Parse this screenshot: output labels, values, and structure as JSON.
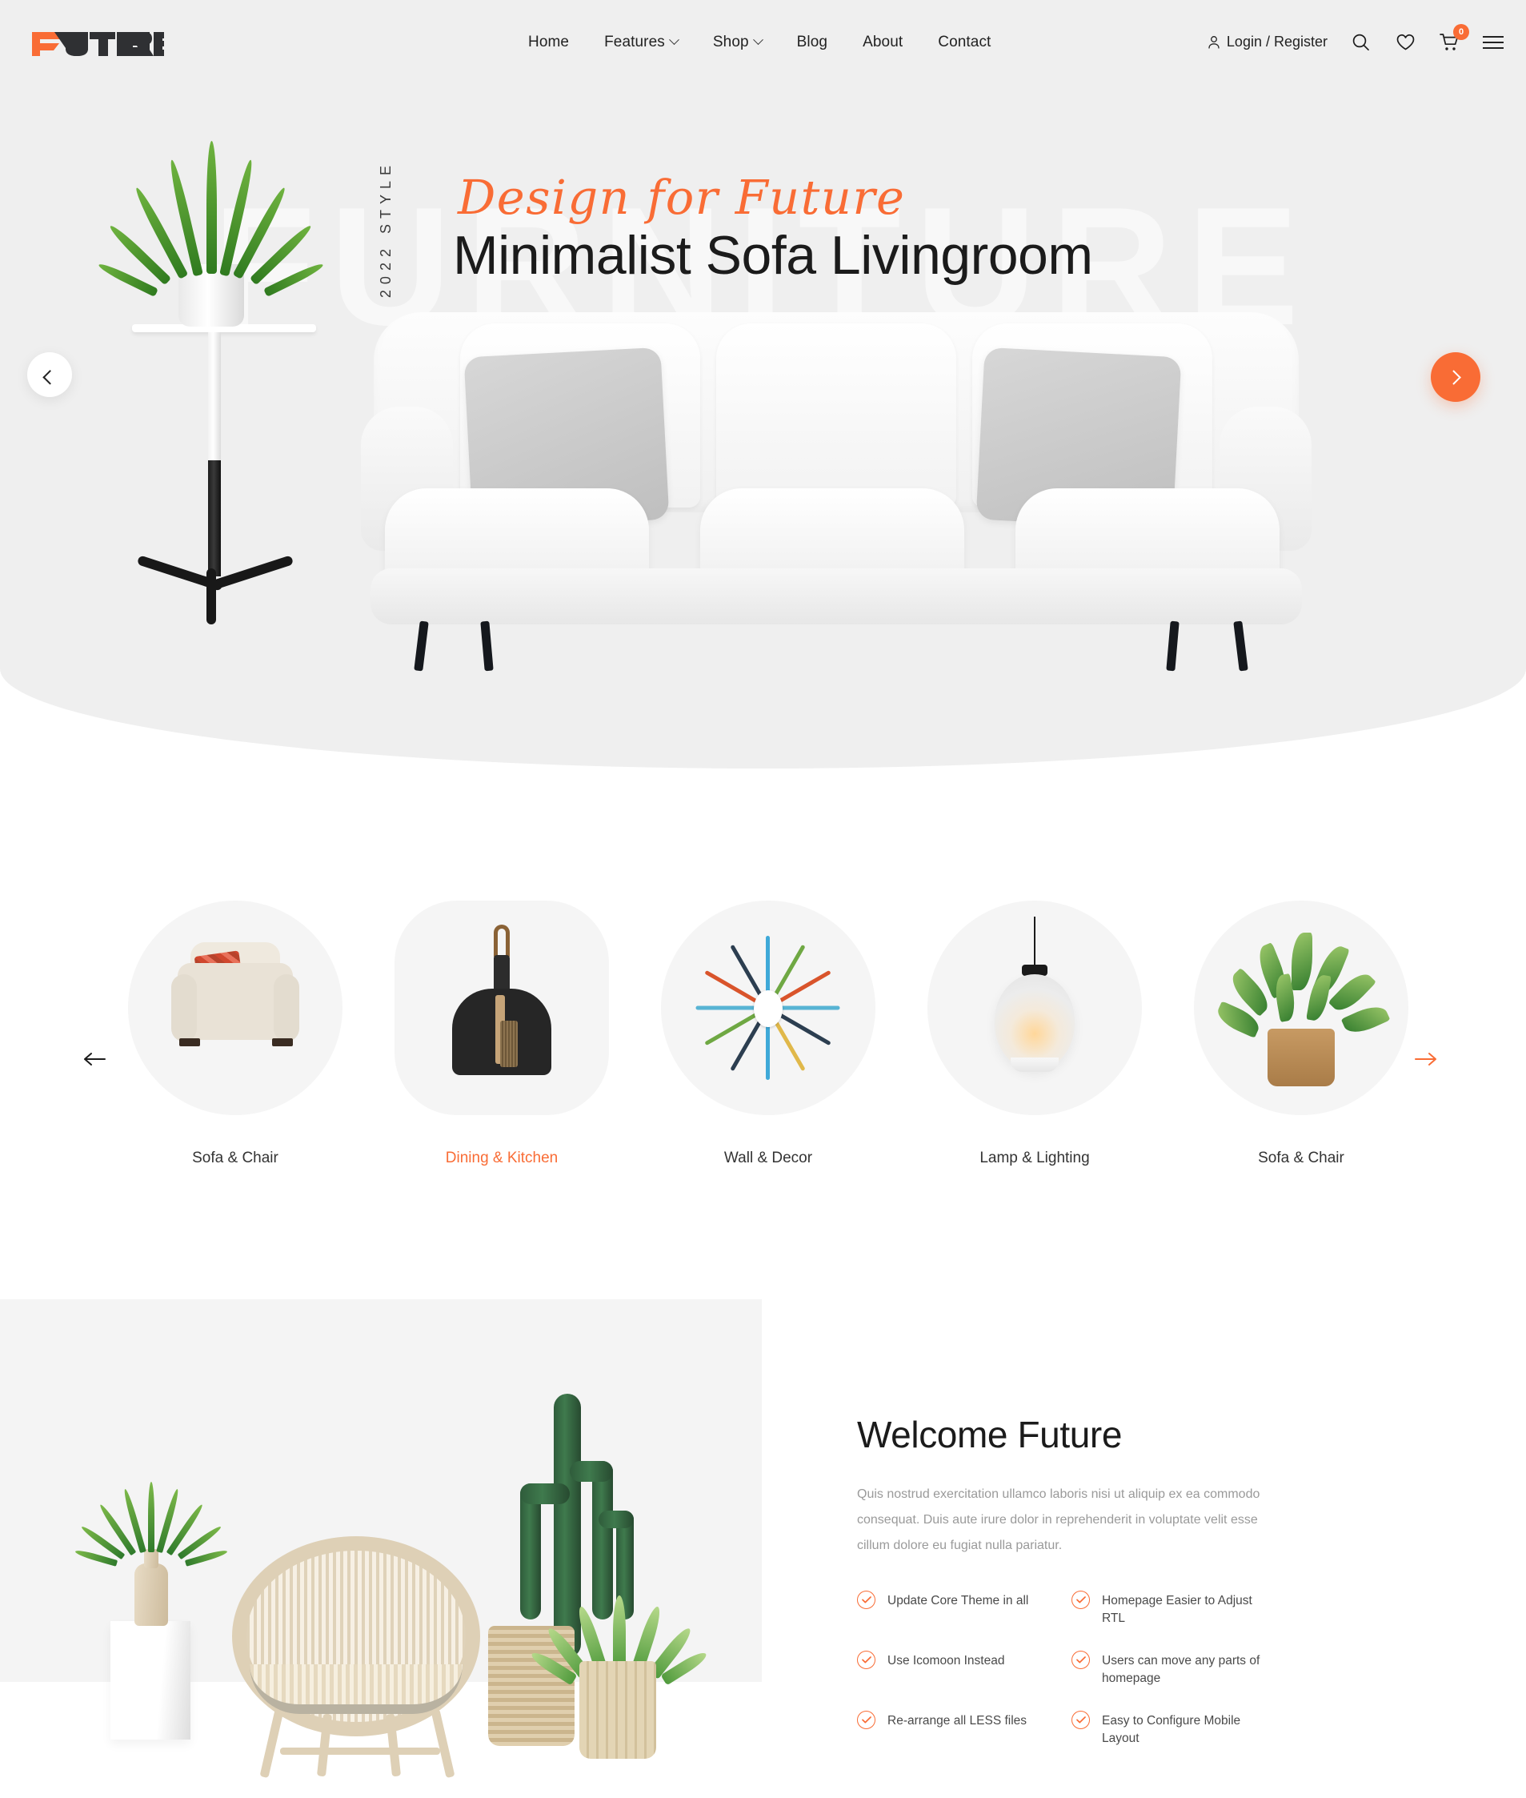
{
  "brand": {
    "name": "FUTURE",
    "accent_color": "#f96c35",
    "dark_color": "#2f3033"
  },
  "header": {
    "nav": [
      {
        "label": "Home",
        "has_dropdown": false
      },
      {
        "label": "Features",
        "has_dropdown": true
      },
      {
        "label": "Shop",
        "has_dropdown": true
      },
      {
        "label": "Blog",
        "has_dropdown": false
      },
      {
        "label": "About",
        "has_dropdown": false
      },
      {
        "label": "Contact",
        "has_dropdown": false
      }
    ],
    "login_label": "Login / Register",
    "icons": {
      "account": "user-icon",
      "search": "search-icon",
      "wishlist": "heart-icon",
      "cart": "cart-icon",
      "menu": "hamburger-icon"
    },
    "cart_count": "0"
  },
  "hero": {
    "watermark": "FURNITURE",
    "vertical_label": "2022 STYLE",
    "script_title": "Design for Future",
    "title": "Minimalist Sofa Livingroom",
    "prev_icon": "chevron-left-icon",
    "next_icon": "chevron-right-icon"
  },
  "categories": {
    "prev_icon": "arrow-left-icon",
    "next_icon": "arrow-right-icon",
    "items": [
      {
        "label": "Sofa & Chair",
        "active": false,
        "art": "armchair"
      },
      {
        "label": "Dining & Kitchen",
        "active": true,
        "art": "dustpan"
      },
      {
        "label": "Wall & Decor",
        "active": false,
        "art": "starburst-clock"
      },
      {
        "label": "Lamp & Lighting",
        "active": false,
        "art": "pendant-lamp"
      },
      {
        "label": "Sofa & Chair",
        "active": false,
        "art": "potted-plant"
      }
    ]
  },
  "welcome": {
    "title": "Welcome Future",
    "description": "Quis nostrud exercitation ullamco laboris nisi ut aliquip ex ea commodo consequat. Duis aute irure dolor in reprehenderit in voluptate velit esse cillum dolore eu fugiat nulla pariatur.",
    "features": [
      {
        "label": "Update Core Theme in all"
      },
      {
        "label": "Homepage Easier to Adjust RTL"
      },
      {
        "label": "Use Icomoon Instead"
      },
      {
        "label": "Users can move any parts of homepage"
      },
      {
        "label": "Re-arrange all LESS files"
      },
      {
        "label": "Easy to Configure Mobile Layout"
      }
    ]
  }
}
